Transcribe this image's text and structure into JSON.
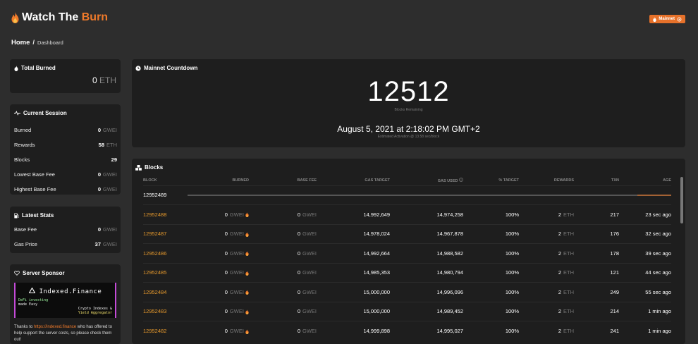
{
  "header": {
    "title_main": "Watch The",
    "title_accent": "Burn",
    "network_label": "Mainnet"
  },
  "breadcrumb": {
    "home": "Home",
    "sep": "/",
    "current": "Dashboard"
  },
  "total_burned": {
    "title": "Total Burned",
    "value": "0",
    "unit": "ETH"
  },
  "session": {
    "title": "Current Session",
    "rows": [
      {
        "label": "Burned",
        "value": "0",
        "unit": "GWEI"
      },
      {
        "label": "Rewards",
        "value": "58",
        "unit": "ETH"
      },
      {
        "label": "Blocks",
        "value": "29",
        "unit": ""
      },
      {
        "label": "Lowest Base Fee",
        "value": "0",
        "unit": "GWEI"
      },
      {
        "label": "Highest Base Fee",
        "value": "0",
        "unit": "GWEI"
      }
    ]
  },
  "latest": {
    "title": "Latest Stats",
    "rows": [
      {
        "label": "Base Fee",
        "value": "0",
        "unit": "GWEI"
      },
      {
        "label": "Gas Price",
        "value": "37",
        "unit": "GWEI"
      }
    ]
  },
  "sponsor": {
    "title": "Server Sponsor",
    "banner_name": "Indexed.Finance",
    "banner_line1": "DeFi investing",
    "banner_line2": "made Easy",
    "banner_line3": "Crypto Indexes &",
    "banner_line4": "Yield Aggregator",
    "text_before": "Thanks to ",
    "link": "https://indexed.finance",
    "text_after": " who has offered to help support the server costs, so please check them out!"
  },
  "countdown": {
    "title": "Mainnet Countdown",
    "blocks": "12512",
    "blocks_label": "Blocks Remaining",
    "date": "August 5, 2021 at 2:18:02 PM GMT+2",
    "date_label": "Estimated Activation @ 13.58 sec/block"
  },
  "blocks": {
    "title": "Blocks",
    "headers": [
      "Block",
      "Burned",
      "Base Fee",
      "Gas Target",
      "Gas Used",
      "% Target",
      "Rewards",
      "TXN",
      "Age"
    ],
    "pending": "12952489",
    "rows": [
      {
        "block": "12952488",
        "burned": "0",
        "burned_unit": "GWEI",
        "base_fee": "0",
        "base_unit": "GWEI",
        "gas_target": "14,992,649",
        "gas_used": "14,974,258",
        "pct": "100%",
        "rewards": "2",
        "rewards_unit": "ETH",
        "txn": "217",
        "age": "23 sec ago"
      },
      {
        "block": "12952487",
        "burned": "0",
        "burned_unit": "GWEI",
        "base_fee": "0",
        "base_unit": "GWEI",
        "gas_target": "14,978,024",
        "gas_used": "14,967,878",
        "pct": "100%",
        "rewards": "2",
        "rewards_unit": "ETH",
        "txn": "176",
        "age": "32 sec ago"
      },
      {
        "block": "12952486",
        "burned": "0",
        "burned_unit": "GWEI",
        "base_fee": "0",
        "base_unit": "GWEI",
        "gas_target": "14,992,664",
        "gas_used": "14,988,582",
        "pct": "100%",
        "rewards": "2",
        "rewards_unit": "ETH",
        "txn": "178",
        "age": "39 sec ago"
      },
      {
        "block": "12952485",
        "burned": "0",
        "burned_unit": "GWEI",
        "base_fee": "0",
        "base_unit": "GWEI",
        "gas_target": "14,985,353",
        "gas_used": "14,980,794",
        "pct": "100%",
        "rewards": "2",
        "rewards_unit": "ETH",
        "txn": "121",
        "age": "44 sec ago"
      },
      {
        "block": "12952484",
        "burned": "0",
        "burned_unit": "GWEI",
        "base_fee": "0",
        "base_unit": "GWEI",
        "gas_target": "15,000,000",
        "gas_used": "14,996,096",
        "pct": "100%",
        "rewards": "2",
        "rewards_unit": "ETH",
        "txn": "249",
        "age": "55 sec ago"
      },
      {
        "block": "12952483",
        "burned": "0",
        "burned_unit": "GWEI",
        "base_fee": "0",
        "base_unit": "GWEI",
        "gas_target": "15,000,000",
        "gas_used": "14,989,452",
        "pct": "100%",
        "rewards": "2",
        "rewards_unit": "ETH",
        "txn": "214",
        "age": "1 min ago"
      },
      {
        "block": "12952482",
        "burned": "0",
        "burned_unit": "GWEI",
        "base_fee": "0",
        "base_unit": "GWEI",
        "gas_target": "14,999,898",
        "gas_used": "14,995,027",
        "pct": "100%",
        "rewards": "2",
        "rewards_unit": "ETH",
        "txn": "241",
        "age": "1 min ago"
      }
    ]
  }
}
